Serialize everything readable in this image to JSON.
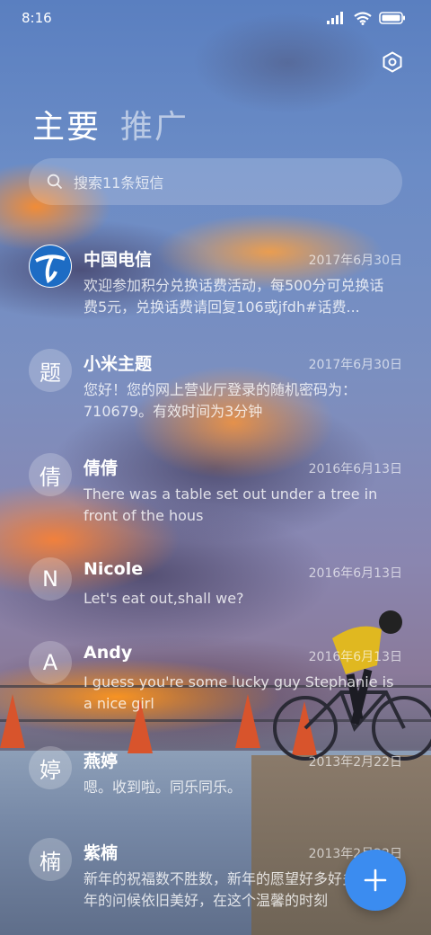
{
  "status_bar": {
    "time": "8:16",
    "icons": [
      "signal-icon",
      "wifi-icon",
      "battery-icon"
    ]
  },
  "header": {
    "settings_icon": "settings-hexagon-icon",
    "tabs": [
      {
        "label": "主要",
        "active": true
      },
      {
        "label": "推广",
        "active": false
      }
    ]
  },
  "search": {
    "placeholder": "搜索11条短信",
    "icon": "search-icon"
  },
  "conversations": [
    {
      "avatar_char": "",
      "avatar_icon": "china-telecom-logo",
      "name": "中国电信",
      "date": "2017年6月30日",
      "preview": "欢迎参加积分兑换话费活动，每500分可兑换话费5元，兑换话费请回复106或jfdh#话费..."
    },
    {
      "avatar_char": "题",
      "name": "小米主题",
      "date": "2017年6月30日",
      "preview": "您好！您的网上营业厅登录的随机密码为：710679。有效时间为3分钟"
    },
    {
      "avatar_char": "倩",
      "name": "倩倩",
      "date": "2016年6月13日",
      "preview": "There was a table set out under a tree in front of the hous"
    },
    {
      "avatar_char": "N",
      "name": "Nicole",
      "date": "2016年6月13日",
      "preview": "Let's eat out,shall we?"
    },
    {
      "avatar_char": "A",
      "name": "Andy",
      "date": "2016年6月13日",
      "preview": "I guess you're some lucky guy Stephanie is a nice girl"
    },
    {
      "avatar_char": "婷",
      "name": "燕婷",
      "date": "2013年2月22日",
      "preview": "嗯。收到啦。同乐同乐。"
    },
    {
      "avatar_char": "楠",
      "name": "紫楠",
      "date": "2013年2月22日",
      "preview": "新年的祝福数不胜数，新年的愿望好多好多，新年的问候依旧美好，在这个温馨的时刻"
    }
  ],
  "fab": {
    "icon": "plus-icon"
  },
  "colors": {
    "accent": "#3b8cf0"
  }
}
